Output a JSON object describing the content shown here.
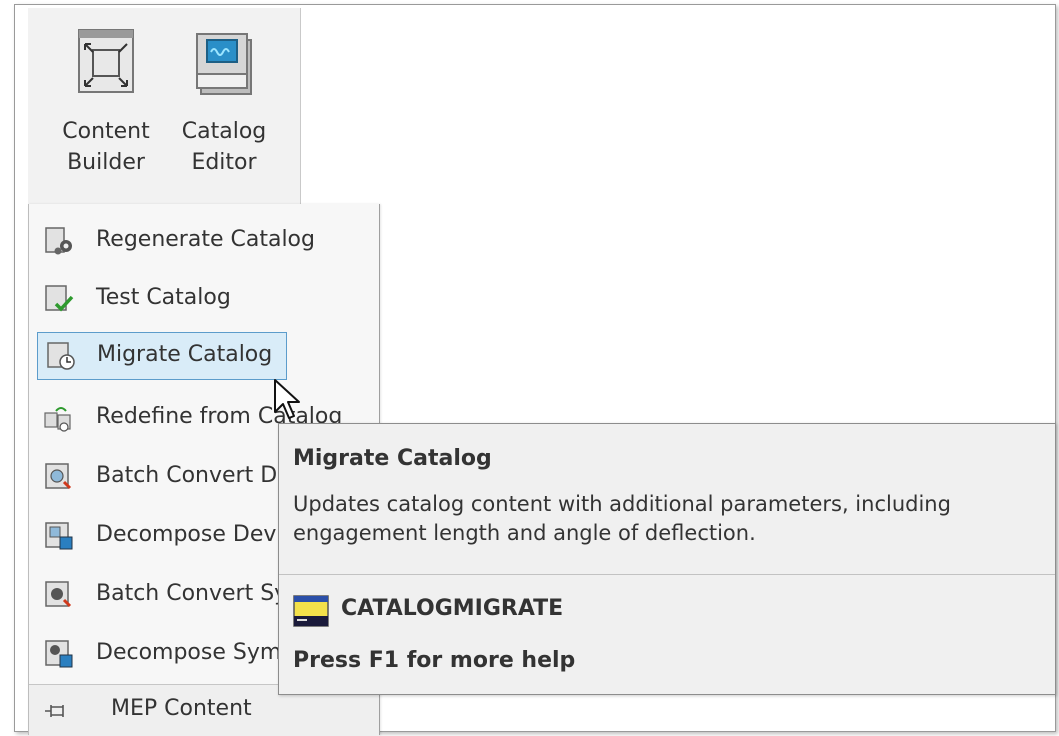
{
  "ribbon": {
    "content_builder_label": "Content\nBuilder",
    "catalog_editor_label": "Catalog\nEditor"
  },
  "menu": {
    "items": [
      {
        "label": "Regenerate Catalog",
        "icon": "regenerate-catalog-icon"
      },
      {
        "label": "Test Catalog",
        "icon": "test-catalog-icon"
      },
      {
        "label": "Migrate Catalog",
        "icon": "migrate-catalog-icon"
      },
      {
        "label": "Redefine from Catalog",
        "icon": "redefine-from-catalog-icon"
      },
      {
        "label": "Batch Convert Devices",
        "icon": "batch-convert-icon"
      },
      {
        "label": "Decompose Devices",
        "icon": "decompose-icon"
      },
      {
        "label": "Batch Convert Symbols",
        "icon": "batch-convert-symbols-icon"
      },
      {
        "label": "Decompose Symbols",
        "icon": "decompose-symbols-icon"
      }
    ],
    "footer_label": "MEP Content"
  },
  "tooltip": {
    "title": "Migrate Catalog",
    "description": "Updates catalog content with additional parameters, including engagement length and angle of deflection.",
    "command": "CATALOGMIGRATE",
    "help": "Press F1 for more help"
  },
  "colors": {
    "highlight_fill": "#d9ecf8",
    "highlight_border": "#5c9ccb",
    "tooltip_bg": "#f0f0f0"
  }
}
